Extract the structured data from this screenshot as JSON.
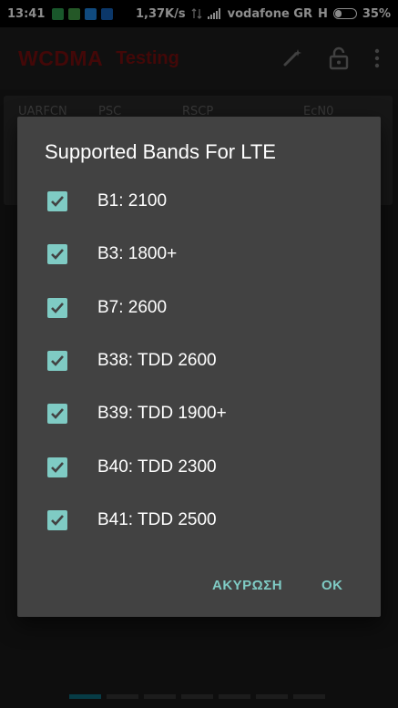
{
  "status_bar": {
    "time": "13:41",
    "speed": "1,37K/s",
    "carrier": "vodafone GR",
    "network_type": "H",
    "battery": "35%",
    "battery_level": 0.35
  },
  "app_bar": {
    "title": "WCDMA",
    "subtitle": "Testing",
    "title_color": "#7a0f0f",
    "icons": [
      "magic-wand-icon",
      "lock-open-icon",
      "overflow-menu-icon"
    ]
  },
  "background_table": {
    "columns": [
      "UARFCN",
      "PSC",
      "RSCP",
      "EcN0"
    ]
  },
  "dialog": {
    "title": "Supported Bands For LTE",
    "bands": [
      {
        "label": "B1: 2100",
        "checked": true
      },
      {
        "label": "B3: 1800+",
        "checked": true
      },
      {
        "label": "B7: 2600",
        "checked": true
      },
      {
        "label": "B38: TDD 2600",
        "checked": true
      },
      {
        "label": "B39: TDD 1900+",
        "checked": true
      },
      {
        "label": "B40: TDD 2300",
        "checked": true
      },
      {
        "label": "B41: TDD 2500",
        "checked": true
      }
    ],
    "cancel_label": "ΑΚΥΡΩΣΗ",
    "ok_label": "OK",
    "accent_color": "#7fcbc4",
    "background_color": "#424242"
  },
  "pager": {
    "pages": 7,
    "active_index": 0,
    "active_color": "#0e6e80"
  }
}
